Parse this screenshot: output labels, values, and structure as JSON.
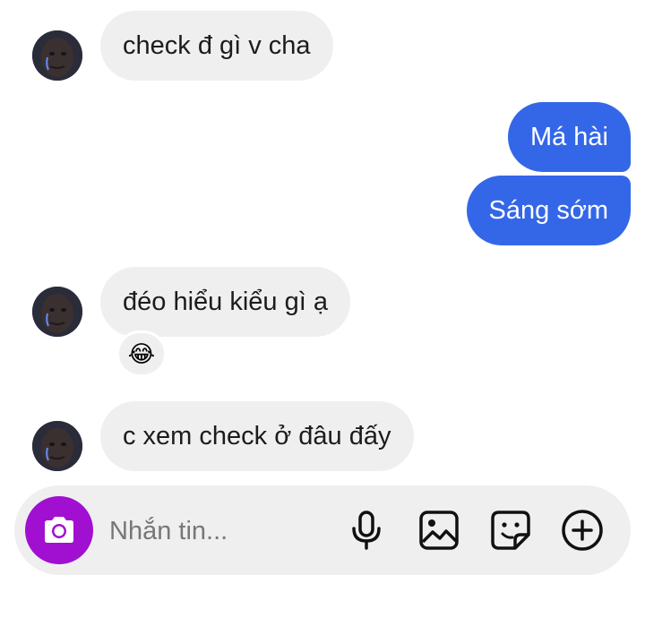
{
  "messages": [
    {
      "direction": "incoming",
      "text": "check đ gì v cha"
    },
    {
      "direction": "outgoing",
      "text": "Má hài"
    },
    {
      "direction": "outgoing",
      "text": "Sáng sớm"
    },
    {
      "direction": "incoming",
      "text": "đéo hiểu kiểu gì ạ",
      "reaction": "😂"
    },
    {
      "direction": "incoming",
      "text": "c xem check ở đâu đấy"
    }
  ],
  "composer": {
    "placeholder": "Nhắn tin...",
    "icons": [
      "camera-icon",
      "microphone-icon",
      "image-icon",
      "sticker-icon",
      "plus-circle-icon"
    ]
  },
  "colors": {
    "incoming_bubble": "#efefef",
    "outgoing_bubble": "#3467e8",
    "camera_button": "#a10fd1"
  }
}
